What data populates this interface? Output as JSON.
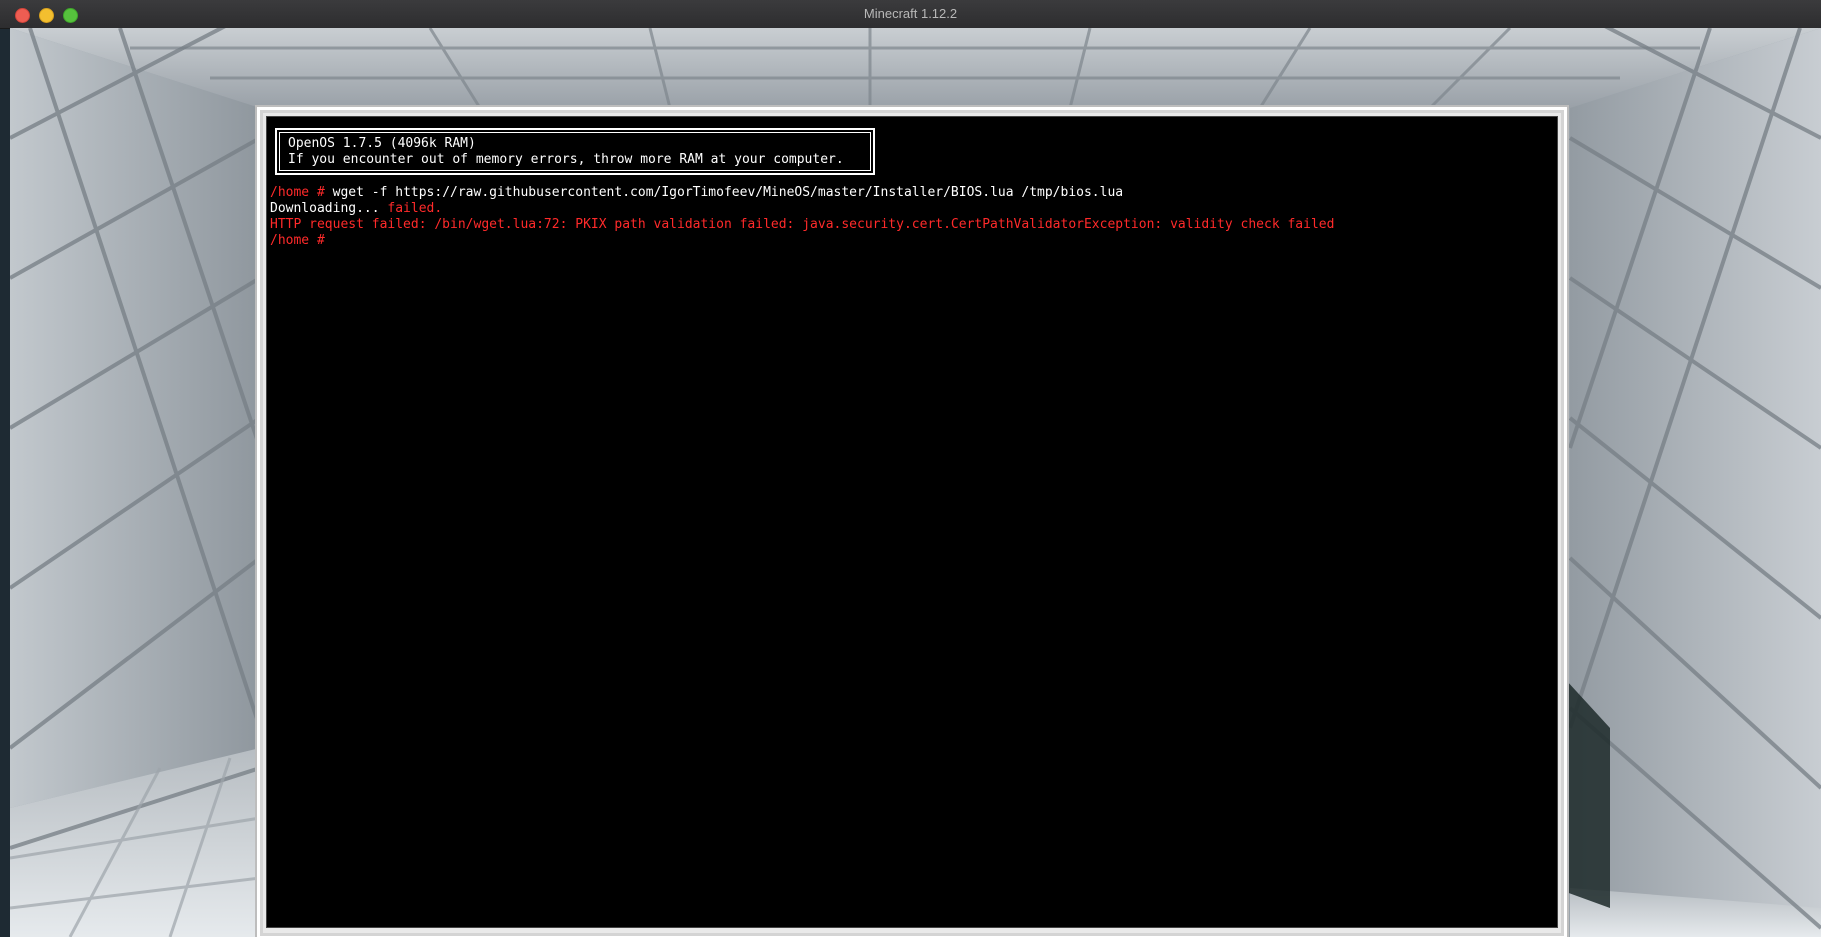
{
  "window": {
    "title": "Minecraft 1.12.2"
  },
  "colors": {
    "terminal_bg": "#000000",
    "terminal_text": "#ffffff",
    "terminal_error": "#ff2a2a",
    "frame": "#e9e9e9"
  },
  "terminal": {
    "banner": {
      "line1": "OpenOS 1.7.5 (4096k RAM)",
      "line2": "If you encounter out of memory errors, throw more RAM at your computer."
    },
    "prompt": "/home # ",
    "command": "wget -f https://raw.githubusercontent.com/IgorTimofeev/MineOS/master/Installer/BIOS.lua /tmp/bios.lua",
    "downloading_label": "Downloading... ",
    "downloading_status": "failed.",
    "error_line": "HTTP request failed: /bin/wget.lua:72: PKIX path validation failed: java.security.cert.CertPathValidatorException: validity check failed",
    "final_prompt": "/home # "
  }
}
